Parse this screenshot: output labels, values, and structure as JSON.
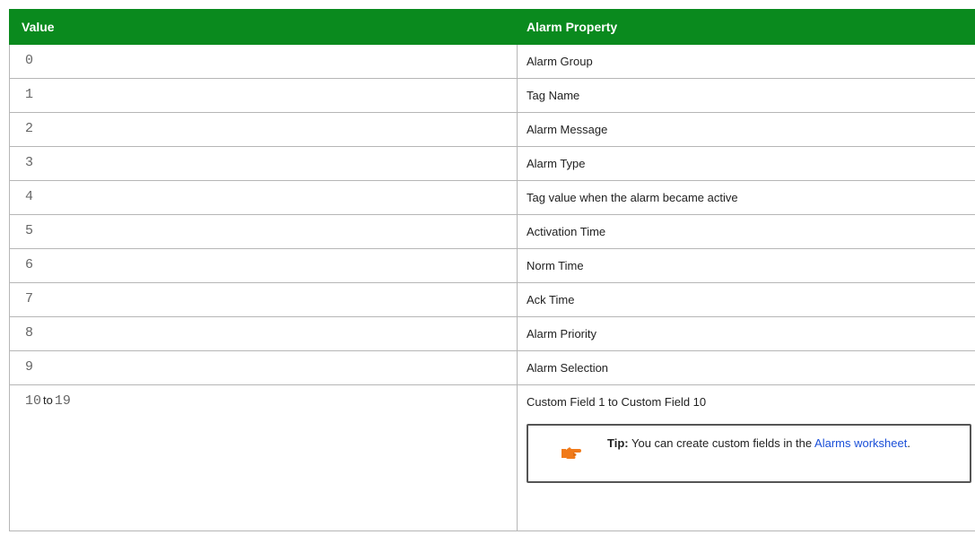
{
  "table": {
    "headers": {
      "value": "Value",
      "property": "Alarm Property"
    },
    "rows": [
      {
        "value": "0",
        "property": "Alarm Group"
      },
      {
        "value": "1",
        "property": "Tag Name"
      },
      {
        "value": "2",
        "property": "Alarm Message"
      },
      {
        "value": "3",
        "property": "Alarm Type"
      },
      {
        "value": "4",
        "property": "Tag value when the alarm became active"
      },
      {
        "value": "5",
        "property": "Activation Time"
      },
      {
        "value": "6",
        "property": "Norm Time"
      },
      {
        "value": "7",
        "property": "Ack Time"
      },
      {
        "value": "8",
        "property": "Alarm Priority"
      },
      {
        "value": "9",
        "property": "Alarm Selection"
      }
    ],
    "last_row": {
      "value_start": "10",
      "value_to": "to",
      "value_end": "19",
      "property": "Custom Field 1 to Custom Field 10"
    }
  },
  "tip": {
    "icon": "pointing-hand-icon",
    "label": "Tip:",
    "text": "You can create custom fields in the",
    "link": "Alarms worksheet",
    "end": "."
  },
  "colors": {
    "header_bg": "#0a8a1e",
    "header_text": "#ffffff",
    "link": "#1a4fd8",
    "icon_orange": "#f07a1a"
  }
}
